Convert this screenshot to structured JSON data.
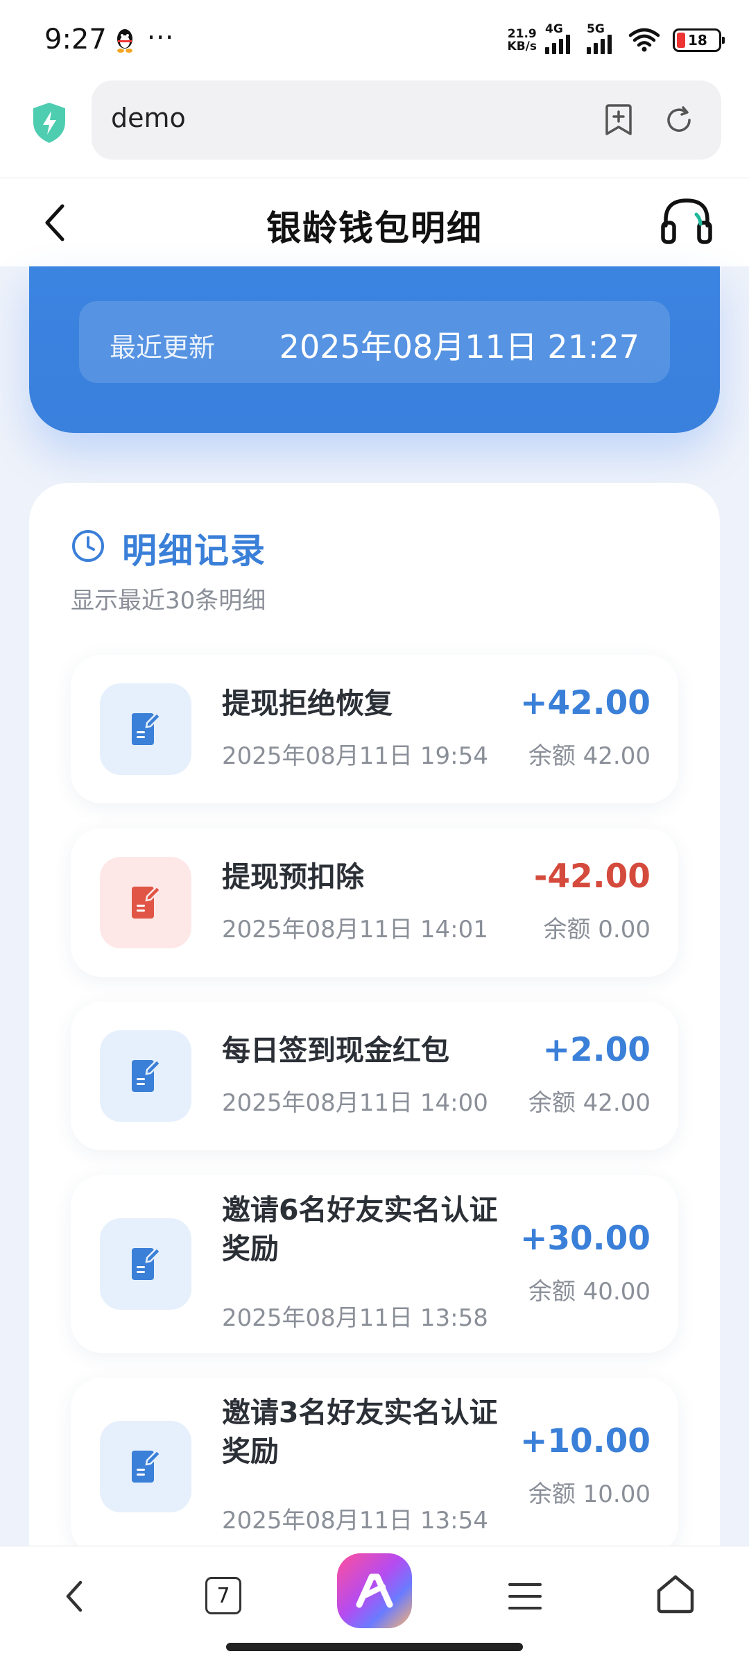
{
  "status_bar": {
    "time": "9:27",
    "more": "···",
    "net_speed_value": "21.9",
    "net_speed_unit": "KB/s",
    "sim1_label": "4G",
    "sim2_label": "5G",
    "battery": "18"
  },
  "browser": {
    "address": "demo"
  },
  "header": {
    "title": "银龄钱包明细"
  },
  "summary": {
    "update_label": "最近更新",
    "update_value": "2025年08月11日 21:27"
  },
  "details": {
    "title": "明细记录",
    "subtitle": "显示最近30条明细",
    "records": [
      {
        "title": "提现拒绝恢复",
        "time": "2025年08月11日 19:54",
        "amount": "+42.00",
        "balance": "余额 42.00"
      },
      {
        "title": "提现预扣除",
        "time": "2025年08月11日 14:01",
        "amount": "-42.00",
        "balance": "余额 0.00"
      },
      {
        "title": "每日签到现金红包",
        "time": "2025年08月11日 14:00",
        "amount": "+2.00",
        "balance": "余额 42.00"
      },
      {
        "title": "邀请6名好友实名认证奖励",
        "time": "2025年08月11日 13:58",
        "amount": "+30.00",
        "balance": "余额 40.00"
      },
      {
        "title": "邀请3名好友实名认证奖励",
        "time": "2025年08月11日 13:54",
        "amount": "+10.00",
        "balance": "余额 10.00"
      }
    ]
  },
  "bottom_nav": {
    "tab_count": "7"
  },
  "colors": {
    "accent_blue": "#3a7fd8",
    "negative_red": "#d44a3c",
    "card_blue": "#3b84e0"
  }
}
